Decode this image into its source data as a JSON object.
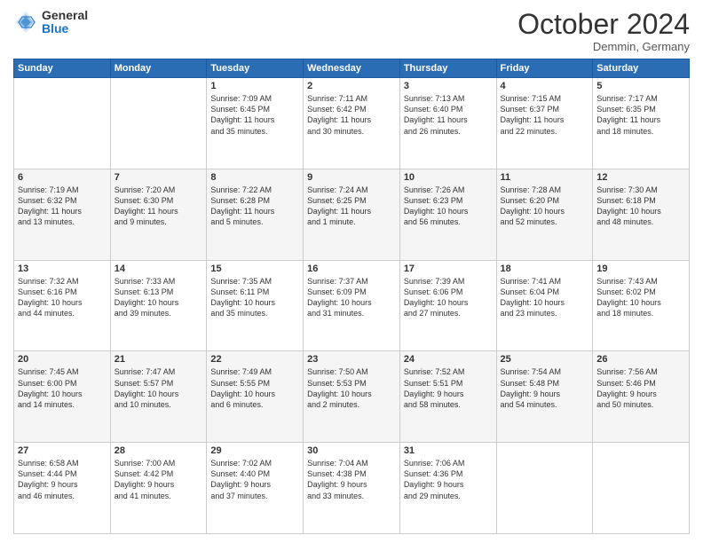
{
  "header": {
    "logo_general": "General",
    "logo_blue": "Blue",
    "month": "October 2024",
    "location": "Demmin, Germany"
  },
  "days_of_week": [
    "Sunday",
    "Monday",
    "Tuesday",
    "Wednesday",
    "Thursday",
    "Friday",
    "Saturday"
  ],
  "weeks": [
    [
      {
        "day": "",
        "info": ""
      },
      {
        "day": "",
        "info": ""
      },
      {
        "day": "1",
        "info": "Sunrise: 7:09 AM\nSunset: 6:45 PM\nDaylight: 11 hours\nand 35 minutes."
      },
      {
        "day": "2",
        "info": "Sunrise: 7:11 AM\nSunset: 6:42 PM\nDaylight: 11 hours\nand 30 minutes."
      },
      {
        "day": "3",
        "info": "Sunrise: 7:13 AM\nSunset: 6:40 PM\nDaylight: 11 hours\nand 26 minutes."
      },
      {
        "day": "4",
        "info": "Sunrise: 7:15 AM\nSunset: 6:37 PM\nDaylight: 11 hours\nand 22 minutes."
      },
      {
        "day": "5",
        "info": "Sunrise: 7:17 AM\nSunset: 6:35 PM\nDaylight: 11 hours\nand 18 minutes."
      }
    ],
    [
      {
        "day": "6",
        "info": "Sunrise: 7:19 AM\nSunset: 6:32 PM\nDaylight: 11 hours\nand 13 minutes."
      },
      {
        "day": "7",
        "info": "Sunrise: 7:20 AM\nSunset: 6:30 PM\nDaylight: 11 hours\nand 9 minutes."
      },
      {
        "day": "8",
        "info": "Sunrise: 7:22 AM\nSunset: 6:28 PM\nDaylight: 11 hours\nand 5 minutes."
      },
      {
        "day": "9",
        "info": "Sunrise: 7:24 AM\nSunset: 6:25 PM\nDaylight: 11 hours\nand 1 minute."
      },
      {
        "day": "10",
        "info": "Sunrise: 7:26 AM\nSunset: 6:23 PM\nDaylight: 10 hours\nand 56 minutes."
      },
      {
        "day": "11",
        "info": "Sunrise: 7:28 AM\nSunset: 6:20 PM\nDaylight: 10 hours\nand 52 minutes."
      },
      {
        "day": "12",
        "info": "Sunrise: 7:30 AM\nSunset: 6:18 PM\nDaylight: 10 hours\nand 48 minutes."
      }
    ],
    [
      {
        "day": "13",
        "info": "Sunrise: 7:32 AM\nSunset: 6:16 PM\nDaylight: 10 hours\nand 44 minutes."
      },
      {
        "day": "14",
        "info": "Sunrise: 7:33 AM\nSunset: 6:13 PM\nDaylight: 10 hours\nand 39 minutes."
      },
      {
        "day": "15",
        "info": "Sunrise: 7:35 AM\nSunset: 6:11 PM\nDaylight: 10 hours\nand 35 minutes."
      },
      {
        "day": "16",
        "info": "Sunrise: 7:37 AM\nSunset: 6:09 PM\nDaylight: 10 hours\nand 31 minutes."
      },
      {
        "day": "17",
        "info": "Sunrise: 7:39 AM\nSunset: 6:06 PM\nDaylight: 10 hours\nand 27 minutes."
      },
      {
        "day": "18",
        "info": "Sunrise: 7:41 AM\nSunset: 6:04 PM\nDaylight: 10 hours\nand 23 minutes."
      },
      {
        "day": "19",
        "info": "Sunrise: 7:43 AM\nSunset: 6:02 PM\nDaylight: 10 hours\nand 18 minutes."
      }
    ],
    [
      {
        "day": "20",
        "info": "Sunrise: 7:45 AM\nSunset: 6:00 PM\nDaylight: 10 hours\nand 14 minutes."
      },
      {
        "day": "21",
        "info": "Sunrise: 7:47 AM\nSunset: 5:57 PM\nDaylight: 10 hours\nand 10 minutes."
      },
      {
        "day": "22",
        "info": "Sunrise: 7:49 AM\nSunset: 5:55 PM\nDaylight: 10 hours\nand 6 minutes."
      },
      {
        "day": "23",
        "info": "Sunrise: 7:50 AM\nSunset: 5:53 PM\nDaylight: 10 hours\nand 2 minutes."
      },
      {
        "day": "24",
        "info": "Sunrise: 7:52 AM\nSunset: 5:51 PM\nDaylight: 9 hours\nand 58 minutes."
      },
      {
        "day": "25",
        "info": "Sunrise: 7:54 AM\nSunset: 5:48 PM\nDaylight: 9 hours\nand 54 minutes."
      },
      {
        "day": "26",
        "info": "Sunrise: 7:56 AM\nSunset: 5:46 PM\nDaylight: 9 hours\nand 50 minutes."
      }
    ],
    [
      {
        "day": "27",
        "info": "Sunrise: 6:58 AM\nSunset: 4:44 PM\nDaylight: 9 hours\nand 46 minutes."
      },
      {
        "day": "28",
        "info": "Sunrise: 7:00 AM\nSunset: 4:42 PM\nDaylight: 9 hours\nand 41 minutes."
      },
      {
        "day": "29",
        "info": "Sunrise: 7:02 AM\nSunset: 4:40 PM\nDaylight: 9 hours\nand 37 minutes."
      },
      {
        "day": "30",
        "info": "Sunrise: 7:04 AM\nSunset: 4:38 PM\nDaylight: 9 hours\nand 33 minutes."
      },
      {
        "day": "31",
        "info": "Sunrise: 7:06 AM\nSunset: 4:36 PM\nDaylight: 9 hours\nand 29 minutes."
      },
      {
        "day": "",
        "info": ""
      },
      {
        "day": "",
        "info": ""
      }
    ]
  ]
}
